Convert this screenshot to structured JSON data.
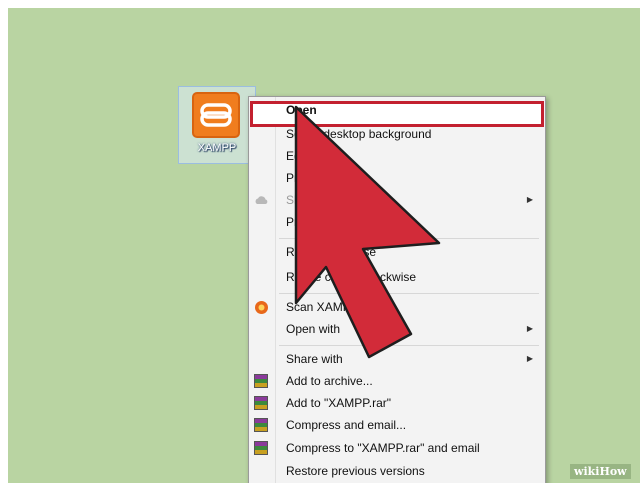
{
  "desktop_icon": {
    "label": "XAMPP",
    "icon": "xampp-logo-icon"
  },
  "context_menu": {
    "items": [
      {
        "label": "Open",
        "highlighted": true
      },
      {
        "label": "Set as desktop background"
      },
      {
        "label": "Edit"
      },
      {
        "label": "Print"
      },
      {
        "label": "SkyDrive Pro",
        "has_submenu": true,
        "icon": "cloud-icon",
        "disabled": true
      },
      {
        "label": "Preview"
      },
      {
        "label": "Rotate clockwise"
      },
      {
        "label": "Rotate counterclockwise"
      },
      {
        "label": "Scan XAMPP.png",
        "icon": "antivirus-icon"
      },
      {
        "label": "Open with",
        "has_submenu": true
      },
      {
        "label": "Share with",
        "has_submenu": true
      },
      {
        "label": "Add to archive...",
        "icon": "winrar-icon"
      },
      {
        "label": "Add to \"XAMPP.rar\"",
        "icon": "winrar-icon"
      },
      {
        "label": "Compress and email...",
        "icon": "winrar-icon"
      },
      {
        "label": "Compress to \"XAMPP.rar\" and email",
        "icon": "winrar-icon"
      },
      {
        "label": "Restore previous versions"
      }
    ]
  },
  "highlight_color": "#c3202f",
  "cursor_color": "#d22b39",
  "watermark": {
    "text": "wikiHow"
  }
}
